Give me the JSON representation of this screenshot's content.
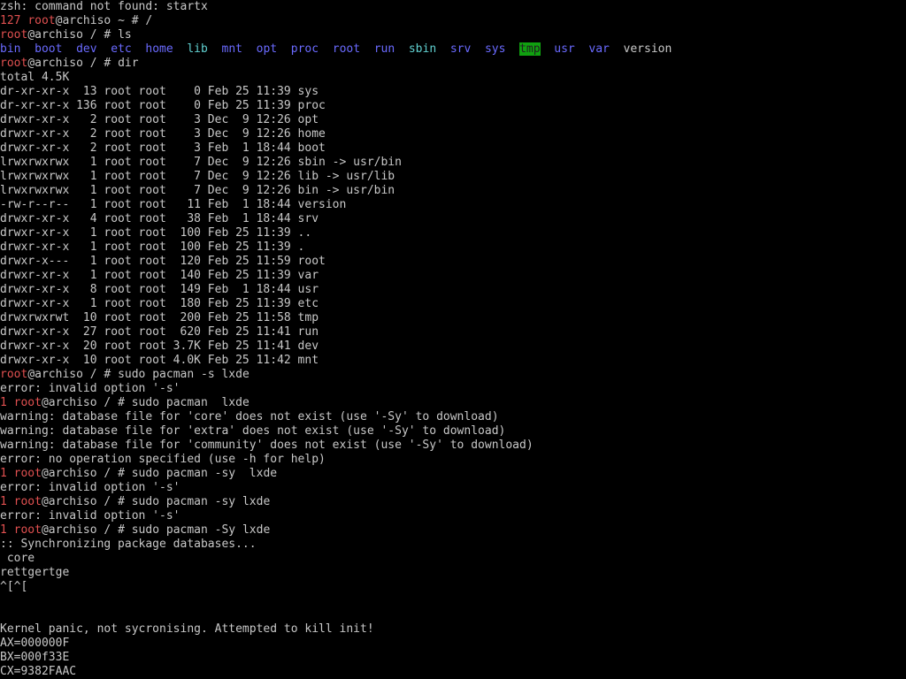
{
  "terminal": {
    "prompt_user": "root",
    "prompt_host": "@archiso",
    "line_startx_err": "zsh: command not found: startx",
    "cmd_cd": "# /",
    "cmd_ls": "# ls",
    "ls_entries": [
      "bin",
      "boot",
      "dev",
      "etc",
      "home",
      "lib",
      "mnt",
      "opt",
      "proc",
      "root",
      "run",
      "sbin",
      "srv",
      "sys",
      "tmp",
      "usr",
      "var",
      "version"
    ],
    "cmd_dir": "# dir",
    "dir_total": "total 4.5K",
    "dir_lines": [
      "dr-xr-xr-x  13 root root    0 Feb 25 11:39 sys",
      "dr-xr-xr-x 136 root root    0 Feb 25 11:39 proc",
      "drwxr-xr-x   2 root root    3 Dec  9 12:26 opt",
      "drwxr-xr-x   2 root root    3 Dec  9 12:26 home",
      "drwxr-xr-x   2 root root    3 Feb  1 18:44 boot",
      "lrwxrwxrwx   1 root root    7 Dec  9 12:26 sbin -> usr/bin",
      "lrwxrwxrwx   1 root root    7 Dec  9 12:26 lib -> usr/lib",
      "lrwxrwxrwx   1 root root    7 Dec  9 12:26 bin -> usr/bin",
      "-rw-r--r--   1 root root   11 Feb  1 18:44 version",
      "drwxr-xr-x   4 root root   38 Feb  1 18:44 srv",
      "drwxr-xr-x   1 root root  100 Feb 25 11:39 ..",
      "drwxr-xr-x   1 root root  100 Feb 25 11:39 .",
      "drwxr-x---   1 root root  120 Feb 25 11:59 root",
      "drwxr-xr-x   1 root root  140 Feb 25 11:39 var",
      "drwxr-xr-x   8 root root  149 Feb  1 18:44 usr",
      "drwxr-xr-x   1 root root  180 Feb 25 11:39 etc",
      "drwxrwxrwt  10 root root  200 Feb 25 11:58 tmp",
      "drwxr-xr-x  27 root root  620 Feb 25 11:41 run",
      "drwxr-xr-x  20 root root 3.7K Feb 25 11:41 dev",
      "drwxr-xr-x  10 root root 4.0K Feb 25 11:42 mnt"
    ],
    "cmd_pacman_s": "# sudo pacman -s lxde",
    "err_invalid_s": "error: invalid option '-s'",
    "cmd_pacman_plain": "# sudo pacman  lxde",
    "warn_core": "warning: database file for 'core' does not exist (use '-Sy' to download)",
    "warn_extra": "warning: database file for 'extra' does not exist (use '-Sy' to download)",
    "warn_community": "warning: database file for 'community' does not exist (use '-Sy' to download)",
    "err_no_op": "error: no operation specified (use -h for help)",
    "cmd_pacman_sy_space": "# sudo pacman -sy  lxde",
    "cmd_pacman_sy": "# sudo pacman -sy lxde",
    "cmd_pacman_Sy": "# sudo pacman -Sy lxde",
    "sync_msg": ":: Synchronizing package databases...",
    "sync_core": " core",
    "garbage": "rettgertge",
    "escape": "^[^[",
    "panic": "Kernel panic, not sycronising. Attempted to kill init!",
    "reg_ax": "AX=000000F",
    "reg_bx": "BX=000f33E",
    "reg_cx": "CX=9382FAAC",
    "status_127": "127",
    "status_1": "1",
    "tilde": "~"
  },
  "colors": {
    "background": "#000000",
    "text": "#c8c8c8",
    "prompt_root": "#e05050",
    "dir_blue": "#6a6aff",
    "link_cyan": "#60d0d0",
    "tmp_bg": "#10a010"
  }
}
